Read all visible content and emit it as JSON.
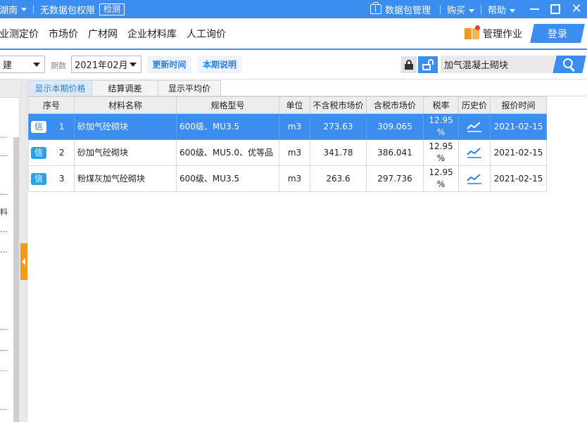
{
  "titlebar": {
    "region": "湖南",
    "no_permission": "无数据包权限",
    "check": "检测",
    "data_package": "数据包管理",
    "buy": "购买",
    "help": "帮助"
  },
  "nav": {
    "items": [
      "业测定价",
      "市场价",
      "广材网",
      "企业材料库",
      "人工询价"
    ],
    "manage_work": "管理作业",
    "login": "登录"
  },
  "toolbar": {
    "region_value": "建",
    "period_label": "期数",
    "period_value": "2021年02月",
    "update_time": "更新时间",
    "period_note": "本期说明",
    "search_value": "加气混凝土砌块"
  },
  "left_panel": {
    "fragments": [
      "...",
      "...",
      "...",
      "料",
      "...",
      "...",
      "...",
      "...",
      "...",
      "..."
    ]
  },
  "tabs": [
    "显示本期价格",
    "结算调差",
    "显示平均价"
  ],
  "table": {
    "headers": [
      "序号",
      "材料名称",
      "规格型号",
      "单位",
      "不含税市场价",
      "含税市场价",
      "税率",
      "历史价",
      "报价时间"
    ],
    "badge": "信",
    "rows": [
      {
        "no": "1",
        "name": "砂加气砼砌块",
        "spec": "600级、MU3.5",
        "unit": "m3",
        "price_ex": "273.63",
        "price_in": "309.065",
        "tax": "12.95 %",
        "date": "2021-02-15"
      },
      {
        "no": "2",
        "name": "砂加气砼砌块",
        "spec": "600级、MU5.0、优等品",
        "unit": "m3",
        "price_ex": "341.78",
        "price_in": "386.041",
        "tax": "12.95 %",
        "date": "2021-02-15"
      },
      {
        "no": "3",
        "name": "粉煤灰加气砼砌块",
        "spec": "600级、MU3.5",
        "unit": "m3",
        "price_ex": "263.6",
        "price_in": "297.736",
        "tax": "12.95 %",
        "date": "2021-02-15"
      }
    ]
  },
  "colors": {
    "primary": "#3c8df0",
    "accent_orange": "#f39a1d",
    "badge": "#2ea0e0"
  }
}
